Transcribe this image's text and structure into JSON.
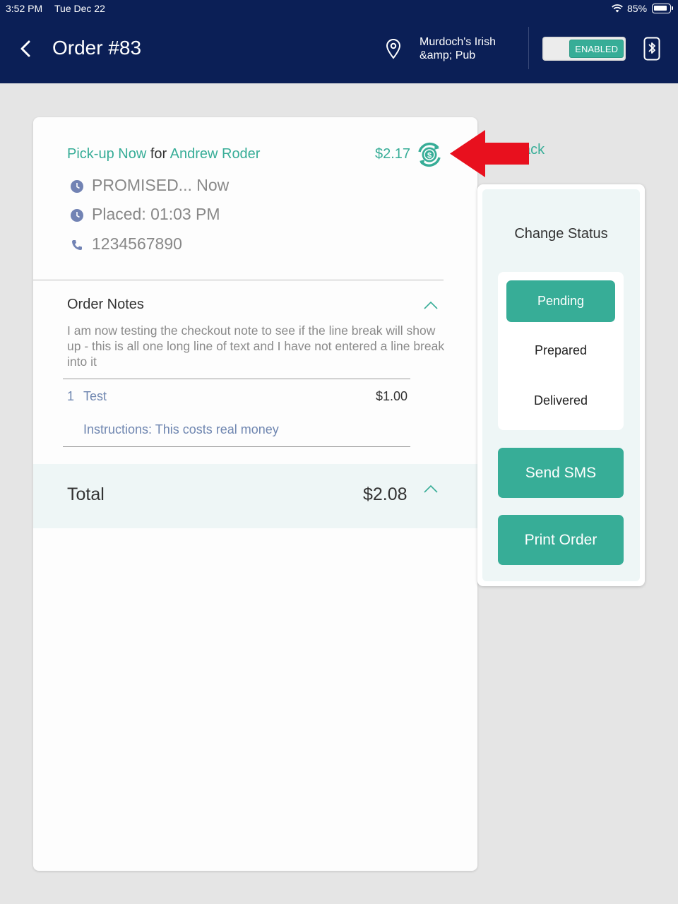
{
  "status_bar": {
    "time": "3:52 PM",
    "date": "Tue Dec 22",
    "battery_pct": "85%",
    "battery_level": 0.85
  },
  "header": {
    "title": "Order #83",
    "location_line1": "Murdoch's Irish",
    "location_line2": "&amp; Pub",
    "toggle_label": "ENABLED"
  },
  "order": {
    "pickup_type": "Pick-up Now",
    "for_word": "for",
    "customer": "Andrew Roder",
    "amount": "$2.17",
    "promised": "PROMISED... Now",
    "placed": "Placed: 01:03 PM",
    "phone": "1234567890",
    "notes_title": "Order Notes",
    "notes_text": "I am now testing the checkout note to see if the line break will show up - this is all one long line of text and I have not entered a line break into it",
    "items": [
      {
        "qty": "1",
        "name": "Test",
        "price": "$1.00",
        "instructions": "Instructions: This costs real money"
      }
    ],
    "total_label": "Total",
    "total_value": "$2.08"
  },
  "back_link": "ack",
  "status_panel": {
    "title": "Change Status",
    "options": [
      "Pending",
      "Prepared",
      "Delivered"
    ],
    "active": "Pending",
    "send_sms": "Send SMS",
    "print_order": "Print Order"
  },
  "colors": {
    "navy": "#0b1f56",
    "teal": "#37ad97",
    "annotation_red": "#e8101e"
  }
}
